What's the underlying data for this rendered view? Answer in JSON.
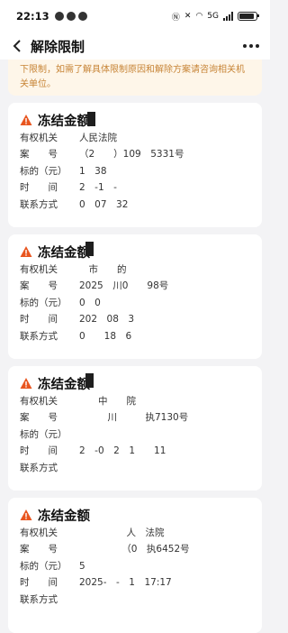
{
  "status_bar": {
    "time": "22:13",
    "network": "5G",
    "icons": [
      "nfc-icon",
      "silent-icon",
      "wifi-icon",
      "signal-icon",
      "battery-icon"
    ]
  },
  "nav": {
    "title": "解除限制"
  },
  "notice": {
    "text": "下限制，如需了解具体限制原因和解除方案请咨询相关机关单位。"
  },
  "cards": [
    {
      "title": "冻结金额",
      "rows": [
        {
          "label": "有权机关",
          "value": "人民法院"
        },
        {
          "label": "案　　号",
          "value": "（2　　）109　5331号"
        },
        {
          "label": "标的（元）",
          "value": "1　38"
        },
        {
          "label": "时　　间",
          "value": "2　-1　-　"
        },
        {
          "label": "联系方式",
          "value": "0　07　32"
        }
      ]
    },
    {
      "title": "冻结金额",
      "rows": [
        {
          "label": "有权机关",
          "value": "　市　　的"
        },
        {
          "label": "案　　号",
          "value": "2025　川0　　98号"
        },
        {
          "label": "标的（元）",
          "value": "0　0"
        },
        {
          "label": "时　　间",
          "value": "202　08　3"
        },
        {
          "label": "联系方式",
          "value": "0　　18　6"
        }
      ]
    },
    {
      "title": "冻结金额",
      "rows": [
        {
          "label": "有权机关",
          "value": "　　中　　院"
        },
        {
          "label": "案　　号",
          "value": "　　　川　　　执7130号"
        },
        {
          "label": "标的（元）",
          "value": "　　"
        },
        {
          "label": "时　　间",
          "value": "2　-0　2　1　　11"
        },
        {
          "label": "联系方式",
          "value": "　　　"
        }
      ]
    },
    {
      "title": "冻结金额",
      "rows": [
        {
          "label": "有权机关",
          "value": "　　　　　人　法院"
        },
        {
          "label": "案　　号",
          "value": "　　　　　（0　执6452号"
        },
        {
          "label": "标的（元）",
          "value": "5"
        },
        {
          "label": "时　　间",
          "value": "2025-　-　1　17:17"
        },
        {
          "label": "联系方式",
          "value": "　　"
        }
      ]
    }
  ],
  "colors": {
    "accent_warning": "#e8551f",
    "notice_bg": "#fef6e9",
    "notice_text": "#c78436",
    "page_bg": "#f3f3f5"
  }
}
